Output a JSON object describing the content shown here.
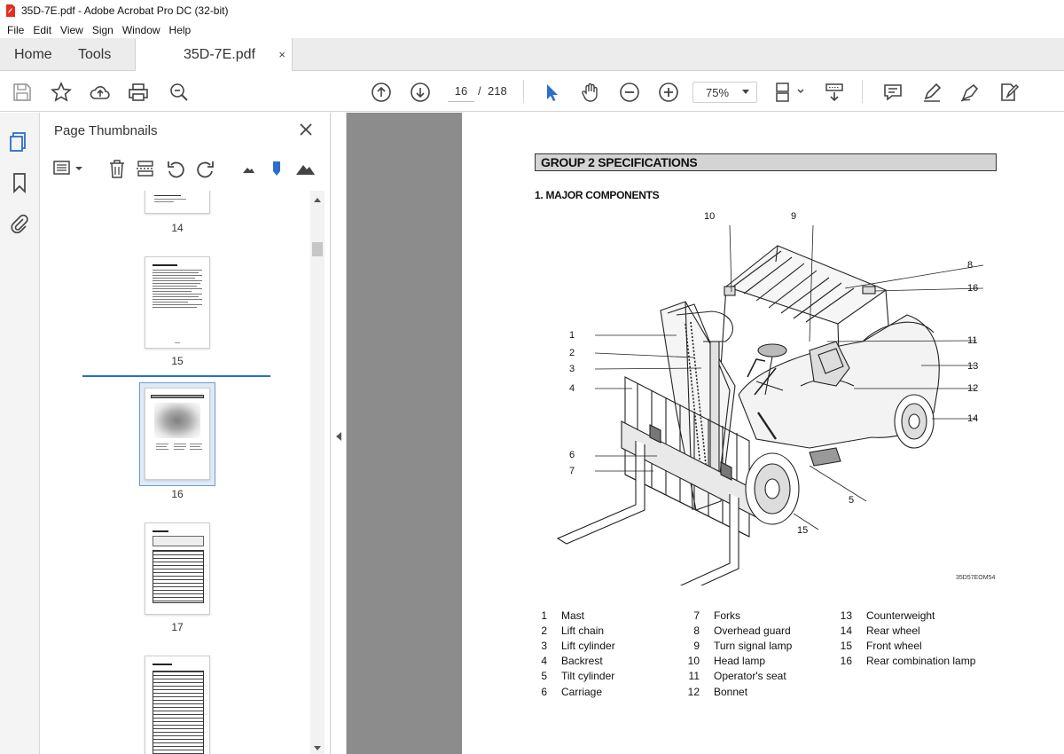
{
  "window": {
    "title": "35D-7E.pdf - Adobe Acrobat Pro DC (32-bit)"
  },
  "menu": [
    "File",
    "Edit",
    "View",
    "Sign",
    "Window",
    "Help"
  ],
  "tabs": {
    "home": "Home",
    "tools": "Tools",
    "document": "35D-7E.pdf",
    "close": "×"
  },
  "toolbar": {
    "page_current": "16",
    "page_sep": "/",
    "page_total": "218",
    "zoom": "75%"
  },
  "thumbnails": {
    "title": "Page Thumbnails",
    "close": "✕",
    "pages": [
      "14",
      "15",
      "16",
      "17"
    ],
    "selected": "16"
  },
  "document": {
    "group_header": "GROUP 2  SPECIFICATIONS",
    "section_title": "1. MAJOR COMPONENTS",
    "illustration_code": "35D57EOM54",
    "callouts": [
      "1",
      "2",
      "3",
      "4",
      "5",
      "6",
      "7",
      "8",
      "9",
      "10",
      "11",
      "12",
      "13",
      "14",
      "15",
      "16"
    ],
    "legend": [
      {
        "num": "1",
        "label": "Mast"
      },
      {
        "num": "2",
        "label": "Lift chain"
      },
      {
        "num": "3",
        "label": "Lift cylinder"
      },
      {
        "num": "4",
        "label": "Backrest"
      },
      {
        "num": "5",
        "label": "Tilt cylinder"
      },
      {
        "num": "6",
        "label": "Carriage"
      },
      {
        "num": "7",
        "label": "Forks"
      },
      {
        "num": "8",
        "label": "Overhead guard"
      },
      {
        "num": "9",
        "label": "Turn signal lamp"
      },
      {
        "num": "10",
        "label": "Head lamp"
      },
      {
        "num": "11",
        "label": "Operator's seat"
      },
      {
        "num": "12",
        "label": "Bonnet"
      },
      {
        "num": "13",
        "label": "Counterweight"
      },
      {
        "num": "14",
        "label": "Rear wheel"
      },
      {
        "num": "15",
        "label": "Front wheel"
      },
      {
        "num": "16",
        "label": "Rear combination lamp"
      }
    ]
  },
  "colors": {
    "accent": "#2a6fc9",
    "doc_background": "#8c8c8c",
    "tab_bar": "#ececec",
    "pdf_icon": "#e0301e"
  }
}
